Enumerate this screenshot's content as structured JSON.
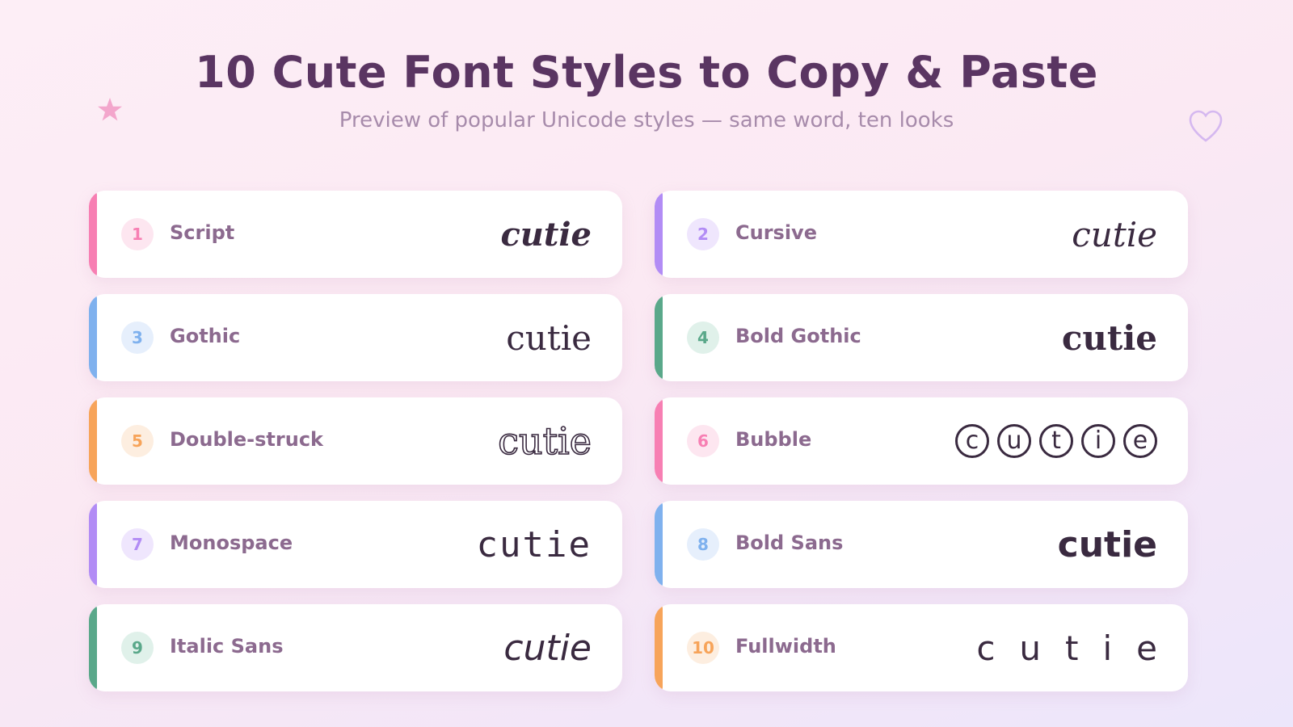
{
  "header": {
    "title": "10 Cute Font Styles to Copy & Paste",
    "subtitle": "Preview of popular Unicode styles — same word, ten looks"
  },
  "decor": {
    "star_icon": "star-icon",
    "heart_icon": "heart-outline-icon",
    "star_color": "#f3a6cc",
    "heart_color": "#d5b8f0"
  },
  "word": "cutie",
  "styles": [
    {
      "number": "1",
      "name": "Script",
      "sample": "cutie",
      "accent": "#f77fb3",
      "badge_bg": "#fde6f0",
      "badge_fg": "#f77fb3"
    },
    {
      "number": "2",
      "name": "Cursive",
      "sample": "cutie",
      "accent": "#b28cf5",
      "badge_bg": "#efe6fd",
      "badge_fg": "#b28cf5"
    },
    {
      "number": "3",
      "name": "Gothic",
      "sample": "cutie",
      "accent": "#7fb1ee",
      "badge_bg": "#e6effc",
      "badge_fg": "#7fb1ee"
    },
    {
      "number": "4",
      "name": "Bold Gothic",
      "sample": "cutie",
      "accent": "#5aa88a",
      "badge_bg": "#e0f1ea",
      "badge_fg": "#5aa88a"
    },
    {
      "number": "5",
      "name": "Double-struck",
      "sample": "cutie",
      "accent": "#f7a45a",
      "badge_bg": "#fdeee0",
      "badge_fg": "#f7a45a"
    },
    {
      "number": "6",
      "name": "Bubble",
      "sample": [
        "c",
        "u",
        "t",
        "i",
        "e"
      ],
      "accent": "#f77fb3",
      "badge_bg": "#fde6f0",
      "badge_fg": "#f77fb3"
    },
    {
      "number": "7",
      "name": "Monospace",
      "sample": "cutie",
      "accent": "#b28cf5",
      "badge_bg": "#efe6fd",
      "badge_fg": "#b28cf5"
    },
    {
      "number": "8",
      "name": "Bold Sans",
      "sample": "cutie",
      "accent": "#7fb1ee",
      "badge_bg": "#e6effc",
      "badge_fg": "#7fb1ee"
    },
    {
      "number": "9",
      "name": "Italic Sans",
      "sample": "cutie",
      "accent": "#5aa88a",
      "badge_bg": "#e0f1ea",
      "badge_fg": "#5aa88a"
    },
    {
      "number": "10",
      "name": "Fullwidth",
      "sample": "cutie",
      "accent": "#f7a45a",
      "badge_bg": "#fdeee0",
      "badge_fg": "#f7a45a"
    }
  ]
}
